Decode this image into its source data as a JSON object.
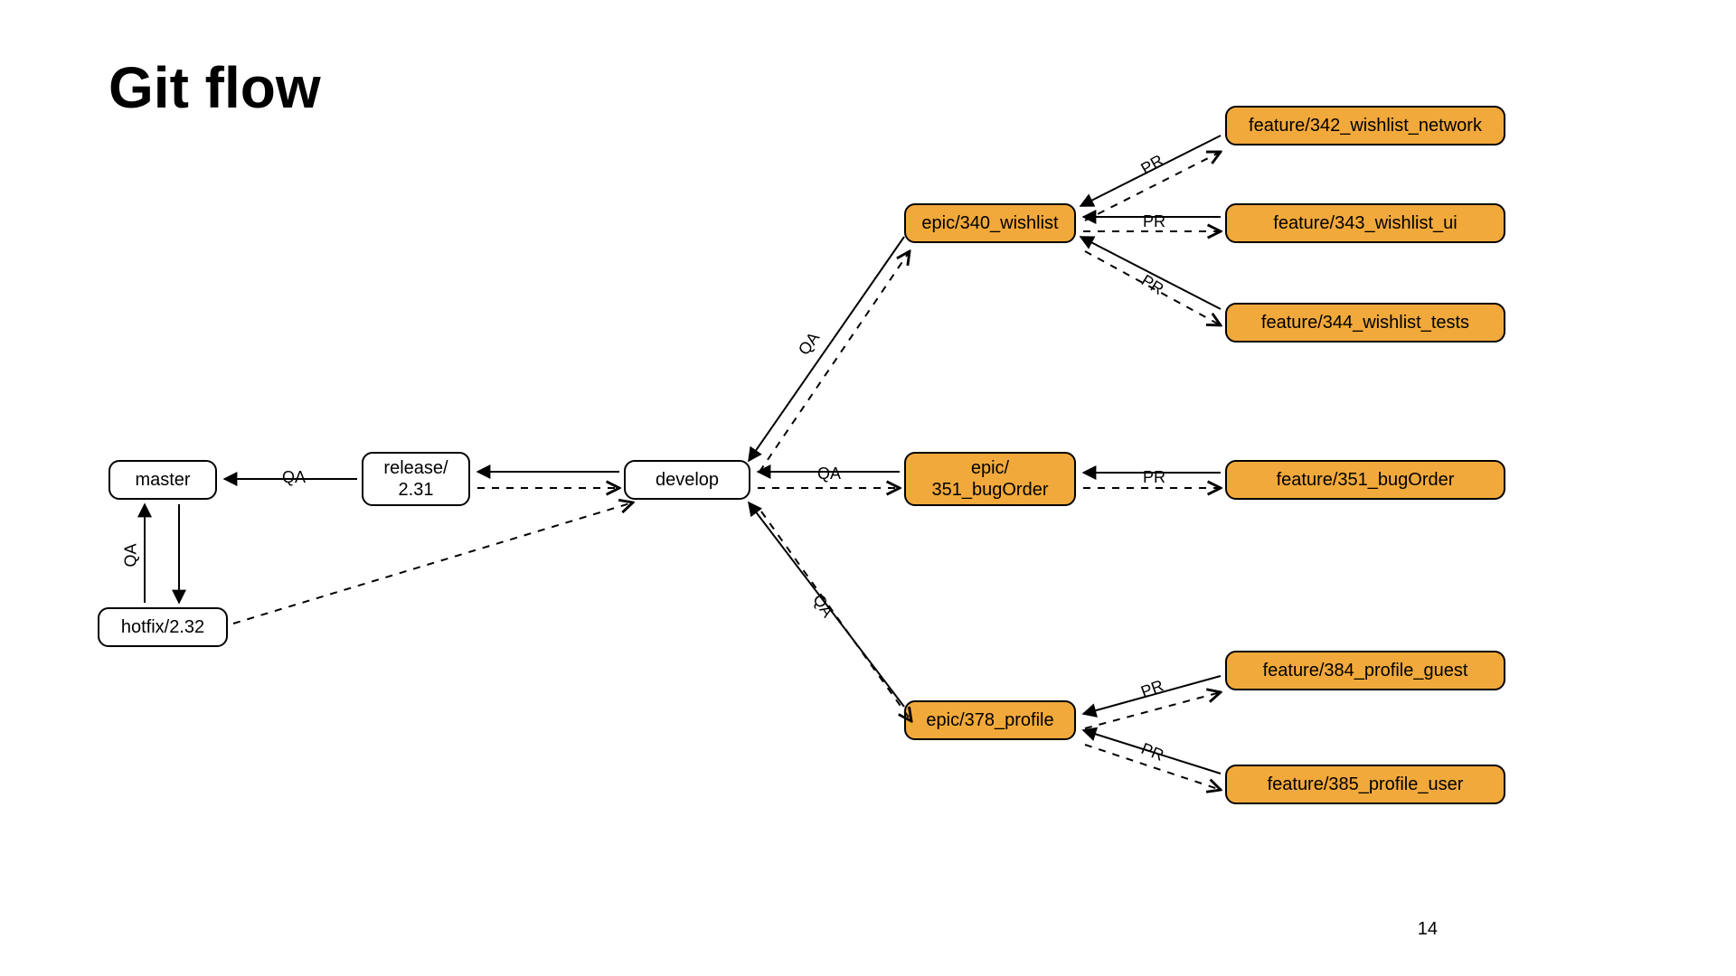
{
  "title": "Git flow",
  "page_number": "14",
  "nodes": {
    "master": {
      "label": "master"
    },
    "release": {
      "label": "release/\n2.31"
    },
    "hotfix": {
      "label": "hotfix/2.32"
    },
    "develop": {
      "label": "develop"
    },
    "epic_wishlist": {
      "label": "epic/340_wishlist"
    },
    "epic_bug": {
      "label": "epic/\n351_bugOrder"
    },
    "epic_profile": {
      "label": "epic/378_profile"
    },
    "feat_342": {
      "label": "feature/342_wishlist_network"
    },
    "feat_343": {
      "label": "feature/343_wishlist_ui"
    },
    "feat_344": {
      "label": "feature/344_wishlist_tests"
    },
    "feat_351": {
      "label": "feature/351_bugOrder"
    },
    "feat_384": {
      "label": "feature/384_profile_guest"
    },
    "feat_385": {
      "label": "feature/385_profile_user"
    }
  },
  "labels": {
    "qa": "QA",
    "pr": "PR"
  }
}
